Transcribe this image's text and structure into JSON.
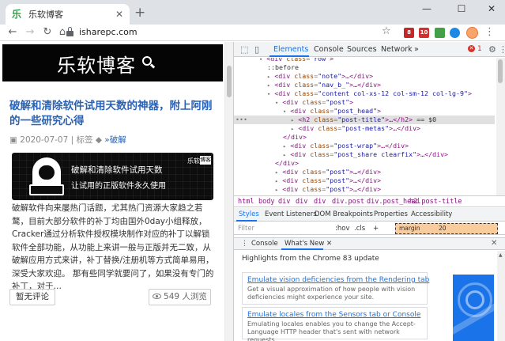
{
  "browser": {
    "tab_title": "乐软博客",
    "tab_favicon": "乐",
    "new_tab": "+",
    "window_controls": [
      "—",
      "☐",
      "✕"
    ],
    "url": "isharepc.com",
    "ext_badges": [
      "8",
      "10"
    ]
  },
  "page": {
    "site_logo": "乐软博客",
    "post_title": "破解和清除软件试用天数的神器，附上阿刚的一些研究心得",
    "post_date": "2020-07-07",
    "post_tag_label": "标签",
    "post_tag": "»破解",
    "banner_line1": "破解和清除软件试用天数",
    "banner_line2": "让试用的正版软件永久使用",
    "banner_brand": "乐软",
    "banner_brand_box": "博客",
    "excerpt": "破解软件向来屡热门话题，尤其热门资源大家趋之若鹜，目前大部分软件的补丁均由国外0day小组释放，Cracker通过分析软件授权模块制作对应的补丁以解锁软件全部功能，从功能上来讲一般与正版并无二致，从破解应用方式来讲，补丁替换/注册机等方式简单易用，深受大家欢迎。 那有些同学就要问了，如果没有专门的补丁，对于…",
    "comment_button": "暂无评论",
    "views_button": "549 人浏览"
  },
  "devtools": {
    "tabs": [
      "Elements",
      "Console",
      "Sources",
      "Network",
      "»"
    ],
    "active_tab": "Elements",
    "error_count": "1",
    "dom_lines": [
      {
        "indent": 1,
        "tri": "▾",
        "tag": "<div ",
        "attr": "class",
        "val": "\"row\"",
        "tail": ">",
        "txt": ""
      },
      {
        "indent": 2,
        "tri": "",
        "tag": "",
        "attr": "",
        "val": "",
        "tail": "",
        "txt": "::before"
      },
      {
        "indent": 2,
        "tri": "▸",
        "tag": "<div ",
        "attr": "class",
        "val": "\"note\"",
        "tail": ">…</div>",
        "txt": ""
      },
      {
        "indent": 2,
        "tri": "▸",
        "tag": "<div ",
        "attr": "class",
        "val": "\"nav_b_\"",
        "tail": ">…</div>",
        "txt": ""
      },
      {
        "indent": 2,
        "tri": "▾",
        "tag": "<div ",
        "attr": "class",
        "val": "\"content col-xs-12 col-sm-12 col-lg-9\"",
        "tail": ">",
        "txt": ""
      },
      {
        "indent": 3,
        "tri": "▾",
        "tag": "<div ",
        "attr": "class",
        "val": "\"post\"",
        "tail": ">",
        "txt": ""
      },
      {
        "indent": 4,
        "tri": "▾",
        "tag": "<div ",
        "attr": "class",
        "val": "\"post_head\"",
        "tail": ">",
        "txt": ""
      },
      {
        "indent": 5,
        "tri": "▸",
        "tag": "<h2 ",
        "attr": "class",
        "val": "\"post-title\"",
        "tail": ">…</h2>",
        "txt": " == $0",
        "selected": true
      },
      {
        "indent": 5,
        "tri": "▸",
        "tag": "<div ",
        "attr": "class",
        "val": "\"post-metas\"",
        "tail": ">…</div>",
        "txt": ""
      },
      {
        "indent": 4,
        "tri": "",
        "tag": "</div>",
        "attr": "",
        "val": "",
        "tail": "",
        "txt": ""
      },
      {
        "indent": 4,
        "tri": "▸",
        "tag": "<div ",
        "attr": "class",
        "val": "\"post-wrap\"",
        "tail": ">…</div>",
        "txt": ""
      },
      {
        "indent": 4,
        "tri": "▸",
        "tag": "<div ",
        "attr": "class",
        "val": "\"post_share clearfix\"",
        "tail": ">…</div>",
        "txt": ""
      },
      {
        "indent": 3,
        "tri": "",
        "tag": "</div>",
        "attr": "",
        "val": "",
        "tail": "",
        "txt": ""
      },
      {
        "indent": 3,
        "tri": "▸",
        "tag": "<div ",
        "attr": "class",
        "val": "\"post\"",
        "tail": ">…</div>",
        "txt": ""
      },
      {
        "indent": 3,
        "tri": "▸",
        "tag": "<div ",
        "attr": "class",
        "val": "\"post\"",
        "tail": ">…</div>",
        "txt": ""
      },
      {
        "indent": 3,
        "tri": "▸",
        "tag": "<div ",
        "attr": "class",
        "val": "\"post\"",
        "tail": ">…</div>",
        "txt": ""
      }
    ],
    "breadcrumbs": [
      "html",
      "body",
      "div",
      "div",
      "div",
      "div.post",
      "div.post_head",
      "h2.post-title"
    ],
    "style_tabs": [
      "Styles",
      "Event Listeners",
      "DOM Breakpoints",
      "Properties",
      "Accessibility"
    ],
    "filter_placeholder": "Filter",
    "filter_options": [
      ":hov",
      ".cls",
      "+"
    ],
    "box_label": "margin",
    "box_value": "20",
    "drawer_tabs": [
      "Console",
      "What's New ✕"
    ],
    "whatsnew_heading": "Highlights from the Chrome 83 update",
    "cards": [
      {
        "title": "Emulate vision deficiencies from the Rendering tab",
        "desc": "Get a visual approximation of how people with vision deficiencies might experience your site."
      },
      {
        "title": "Emulate locales from the Sensors tab or Console",
        "desc": "Emulating locales enables you to change the Accept-Language HTTP header that's sent with network requests."
      }
    ]
  },
  "colors": {
    "link_blue": "#2a63b5",
    "devtools_accent": "#1a73e8",
    "error_red": "#d93025"
  }
}
